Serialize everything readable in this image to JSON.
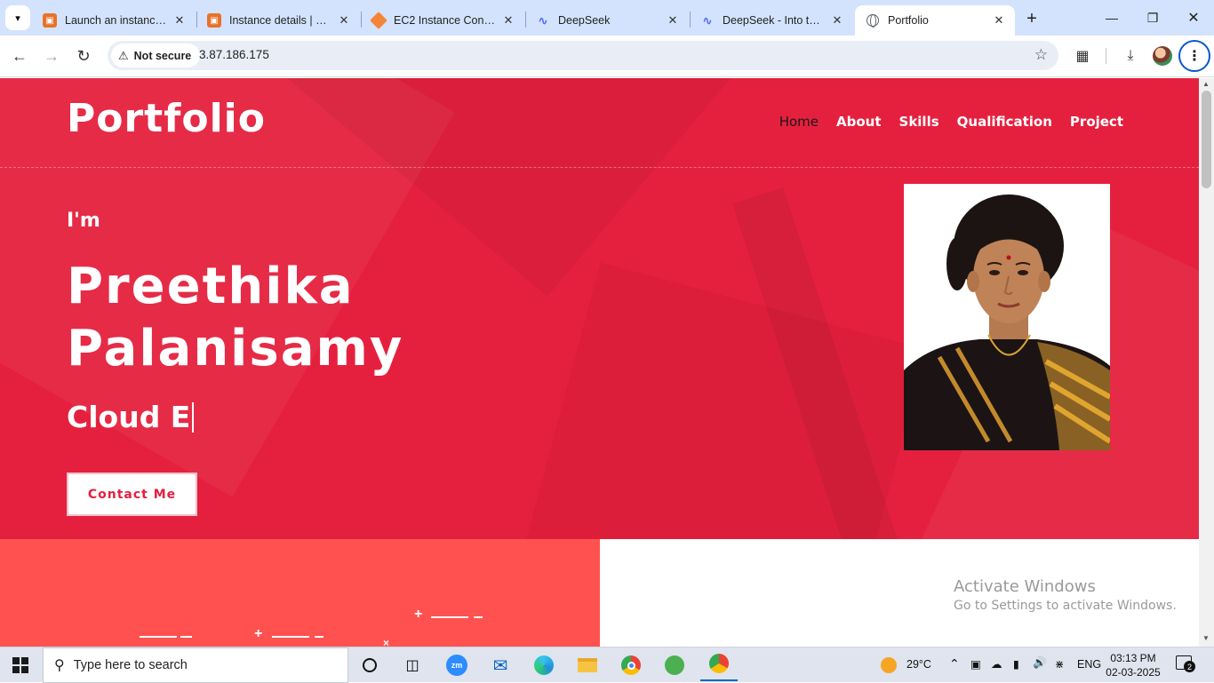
{
  "browser": {
    "tabs": [
      {
        "title": "Launch an instance | E",
        "favicon": "aws-icon"
      },
      {
        "title": "Instance details | EC2",
        "favicon": "aws-icon"
      },
      {
        "title": "EC2 Instance Connect",
        "favicon": "ec2-cube-icon"
      },
      {
        "title": "DeepSeek",
        "favicon": "deepseek-whale-icon"
      },
      {
        "title": "DeepSeek - Into the U",
        "favicon": "deepseek-whale-icon"
      },
      {
        "title": "Portfolio",
        "favicon": "globe-icon",
        "active": true
      }
    ],
    "security_label": "Not secure",
    "url": "3.87.186.175"
  },
  "site": {
    "logo": "Portfolio",
    "nav": [
      "Home",
      "About",
      "Skills",
      "Qualification",
      "Project"
    ],
    "nav_active": "Home",
    "intro": "I'm",
    "name_line1": "Preethika",
    "name_line2": "Palanisamy",
    "role": "Cloud E",
    "contact_button": "Contact Me",
    "accent_color": "#e5203e",
    "secondary_color": "#ff5250"
  },
  "watermark": {
    "line1": "Activate Windows",
    "line2": "Go to Settings to activate Windows."
  },
  "taskbar": {
    "search_placeholder": "Type here to search",
    "weather": "29°C",
    "language": "ENG",
    "time": "03:13 PM",
    "date": "02-03-2025",
    "notification_count": "2"
  }
}
